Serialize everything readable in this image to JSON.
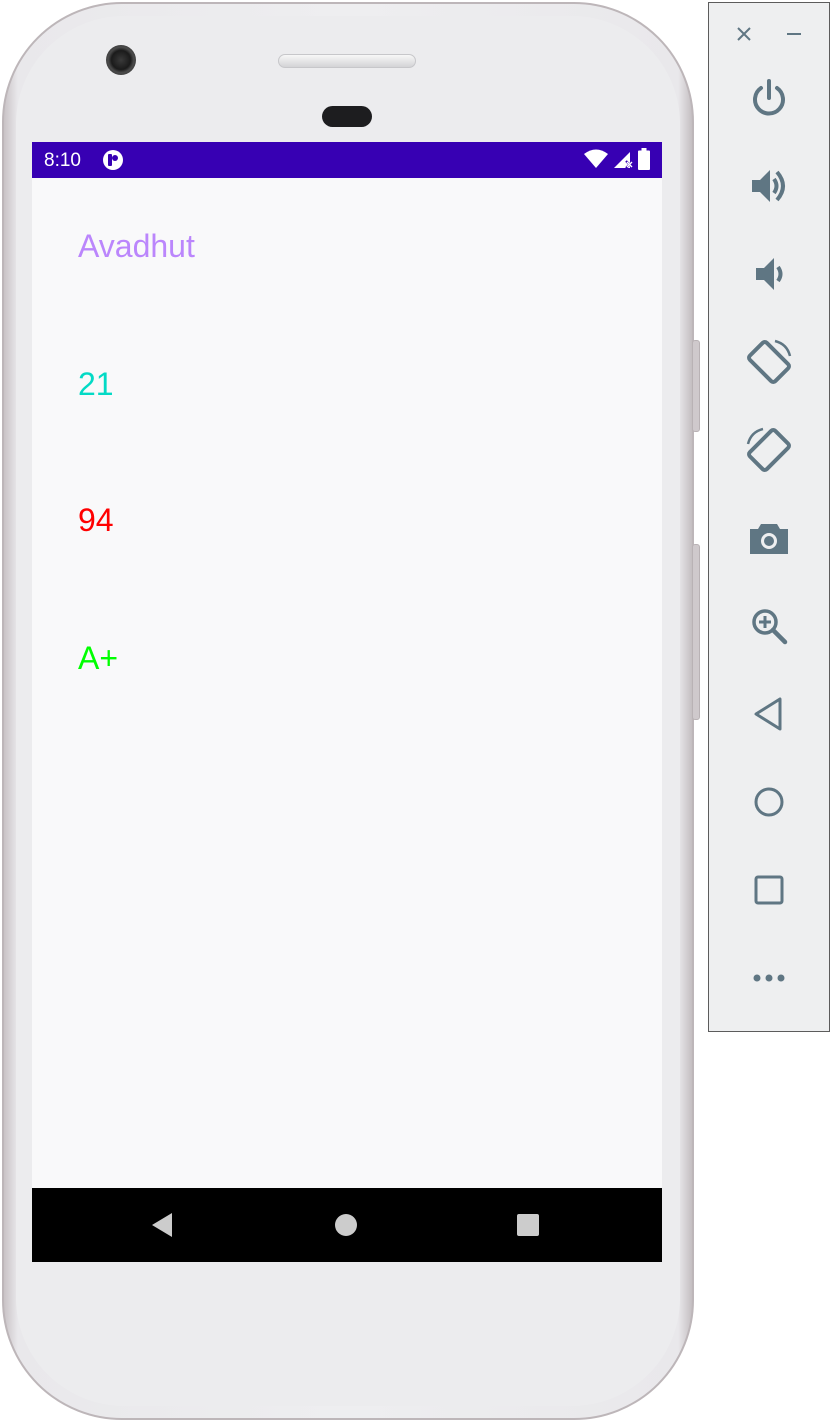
{
  "status_bar": {
    "time": "8:10",
    "icons": [
      "app-notification-icon",
      "wifi-icon",
      "signal-icon",
      "battery-icon"
    ],
    "color": "#3700b3"
  },
  "app": {
    "name_text": "Avadhut",
    "name_color": "#bb86fc",
    "age_text": "21",
    "age_color": "#03dac5",
    "marks_text": "94",
    "marks_color": "#ff0000",
    "grade_text": "A+",
    "grade_color": "#00ff00"
  },
  "nav_bar": {
    "buttons": [
      "back-icon",
      "home-icon",
      "recents-icon"
    ]
  },
  "emulator_toolbar": {
    "top_buttons": [
      "close-icon",
      "minimize-icon"
    ],
    "buttons": [
      "power-icon",
      "volume-up-icon",
      "volume-down-icon",
      "rotate-left-icon",
      "rotate-right-icon",
      "camera-icon",
      "zoom-icon",
      "back-icon",
      "home-icon",
      "overview-icon",
      "more-icon"
    ],
    "icon_color": "#5f7683"
  }
}
